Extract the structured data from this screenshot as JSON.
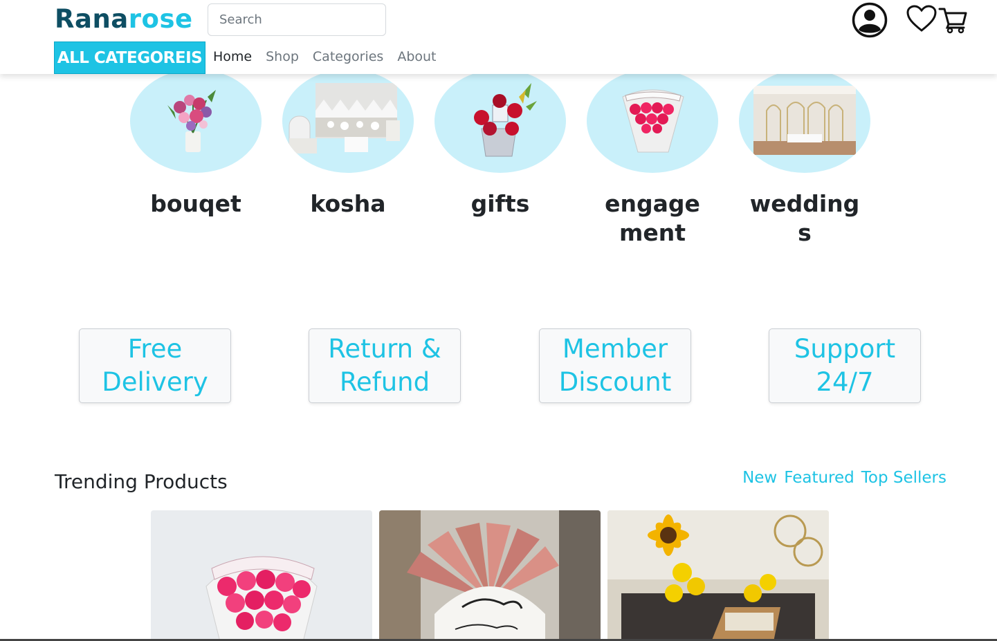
{
  "brand": {
    "part1": "Rana",
    "part2": "rose"
  },
  "search": {
    "placeholder": "Search"
  },
  "header_icons": [
    "user-account-icon",
    "heart-icon",
    "cart-icon"
  ],
  "all_categories_label": "ALL CATEGOREIS",
  "nav": [
    {
      "label": "Home",
      "active": true
    },
    {
      "label": "Shop",
      "active": false
    },
    {
      "label": "Categories",
      "active": false
    },
    {
      "label": "About",
      "active": false
    }
  ],
  "categories": [
    {
      "label": "bouqet",
      "image": "flower-bouquet-vase"
    },
    {
      "label": "kosha",
      "image": "wedding-kosha-stage"
    },
    {
      "label": "gifts",
      "image": "roses-gift-box"
    },
    {
      "label": "engagement",
      "image": "red-roses-wrapped"
    },
    {
      "label": "weddings",
      "image": "wedding-hall-decor"
    }
  ],
  "features": [
    "Free Delivery",
    "Return & Refund",
    "Member Discount",
    "Support 24/7"
  ],
  "trending": {
    "title": "Trending Products",
    "tabs": [
      "New",
      "Featured",
      "Top Sellers"
    ],
    "products": [
      {
        "image": "pink-roses-bouquet"
      },
      {
        "image": "money-fan-arrangement"
      },
      {
        "image": "sunflower-yellow-roses"
      }
    ]
  },
  "colors": {
    "accent": "#1ec3e4",
    "brand_dark": "#0e4e63",
    "circle_bg": "#c9f0fa",
    "text": "#212529",
    "muted": "#6c757d"
  }
}
